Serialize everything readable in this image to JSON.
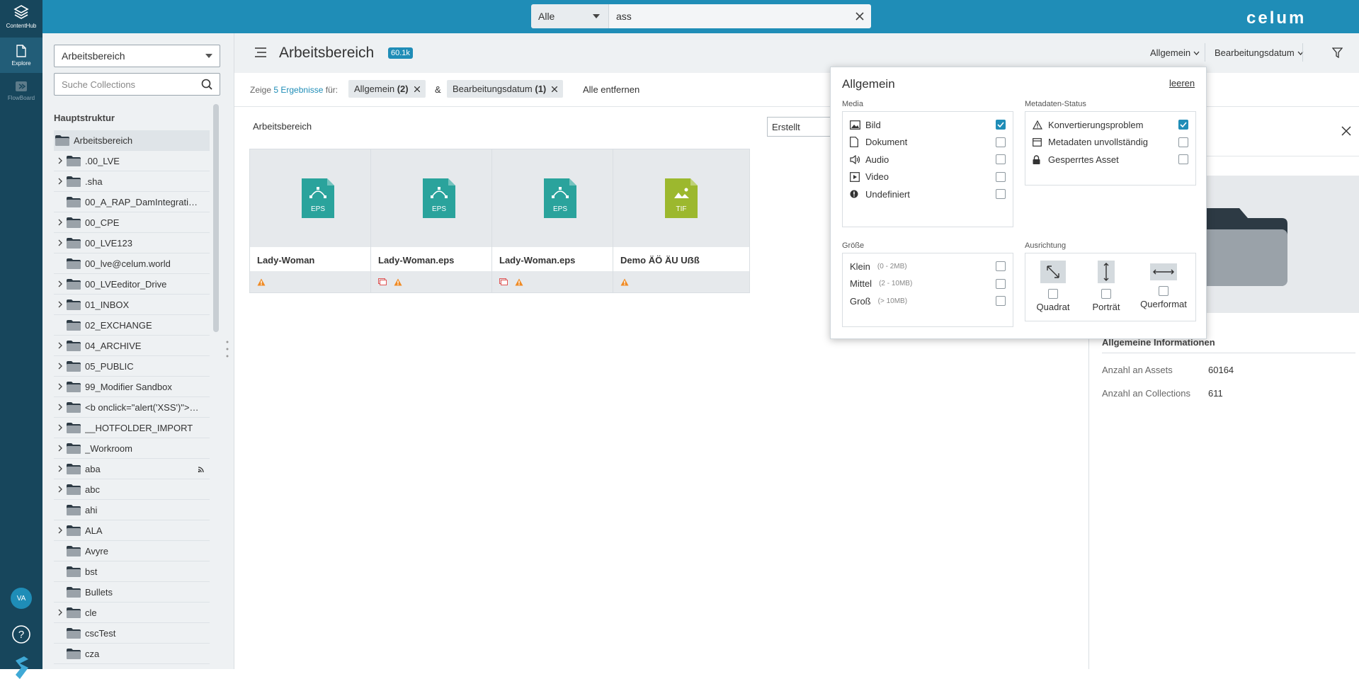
{
  "topbar": {
    "scope_value": "Alle",
    "query": "ass",
    "brand": "celum"
  },
  "leftnav": {
    "items": [
      {
        "label": "ContentHub"
      },
      {
        "label": "Explore"
      },
      {
        "label": "FlowBoard"
      }
    ],
    "avatar": "VA"
  },
  "sidebar": {
    "dropdown": "Arbeitsbereich",
    "search_placeholder": "Suche Collections",
    "tree_heading": "Hauptstruktur",
    "tree": [
      {
        "label": "Arbeitsbereich",
        "chev": false,
        "selected": true,
        "root": true
      },
      {
        "label": ".00_LVE",
        "chev": true
      },
      {
        "label": ".sha",
        "chev": true
      },
      {
        "label": "00_A_RAP_DamIntegrati…",
        "chev": false
      },
      {
        "label": "00_CPE",
        "chev": true
      },
      {
        "label": "00_LVE123",
        "chev": true
      },
      {
        "label": "00_lve@celum.world",
        "chev": false
      },
      {
        "label": "00_LVEeditor_Drive",
        "chev": true
      },
      {
        "label": "01_INBOX",
        "chev": true
      },
      {
        "label": "02_EXCHANGE",
        "chev": false
      },
      {
        "label": "04_ARCHIVE",
        "chev": true
      },
      {
        "label": "05_PUBLIC",
        "chev": true
      },
      {
        "label": "99_Modifier Sandbox",
        "chev": true
      },
      {
        "label": "<b onclick=\"alert('XSS')\">…",
        "chev": true
      },
      {
        "label": "__HOTFOLDER_IMPORT",
        "chev": true
      },
      {
        "label": "_Workroom",
        "chev": true
      },
      {
        "label": "aba",
        "chev": true,
        "feed": true
      },
      {
        "label": "abc",
        "chev": true
      },
      {
        "label": "ahi",
        "chev": false
      },
      {
        "label": "ALA",
        "chev": true
      },
      {
        "label": "Avyre",
        "chev": false
      },
      {
        "label": "bst",
        "chev": false
      },
      {
        "label": "Bullets",
        "chev": false
      },
      {
        "label": "cle",
        "chev": true
      },
      {
        "label": "cscTest",
        "chev": false
      },
      {
        "label": "cza",
        "chev": false
      }
    ]
  },
  "main": {
    "title": "Arbeitsbereich",
    "count_badge": "60.1k",
    "sort_general": "Allgemein",
    "sort_date": "Bearbeitungsdatum",
    "filterbar": {
      "prefix": "Zeige",
      "results": "5 Ergebnisse",
      "suffix": "für:",
      "chip1_label": "Allgemein",
      "chip1_count": "(2)",
      "amp": "&",
      "chip2_label": "Bearbeitungsdatum",
      "chip2_count": "(1)",
      "clear_all": "Alle entfernen"
    },
    "section_title": "Arbeitsbereich",
    "sort_select": "Erstellt",
    "cards": [
      {
        "name": "Lady-Woman",
        "type": "EPS",
        "color": "#2aa39c",
        "link_icon": false
      },
      {
        "name": "Lady-Woman.eps",
        "type": "EPS",
        "color": "#2aa39c",
        "link_icon": true
      },
      {
        "name": "Lady-Woman.eps",
        "type": "EPS",
        "color": "#2aa39c",
        "link_icon": true
      },
      {
        "name": "Demo ÄÖ ÄU Uẞß",
        "type": "TIF",
        "color": "#9cb82e",
        "link_icon": false
      }
    ]
  },
  "detail": {
    "info_heading": "Allgemeine Informationen",
    "rows": [
      {
        "label": "Anzahl an Assets",
        "value": "60164"
      },
      {
        "label": "Anzahl an Collections",
        "value": "611"
      }
    ]
  },
  "popup": {
    "title": "Allgemein",
    "clear": "leeren",
    "media_heading": "Media",
    "media": [
      {
        "label": "Bild",
        "icon": "image-icon",
        "checked": true
      },
      {
        "label": "Dokument",
        "icon": "document-icon",
        "checked": false
      },
      {
        "label": "Audio",
        "icon": "audio-icon",
        "checked": false
      },
      {
        "label": "Video",
        "icon": "video-icon",
        "checked": false
      },
      {
        "label": "Undefiniert",
        "icon": "undefined-icon",
        "checked": false
      }
    ],
    "meta_heading": "Metadaten-Status",
    "meta": [
      {
        "label": "Konvertierungsproblem",
        "icon": "warning-icon",
        "checked": true
      },
      {
        "label": "Metadaten unvollständig",
        "icon": "metadata-icon",
        "checked": false
      },
      {
        "label": "Gesperrtes Asset",
        "icon": "lock-icon",
        "checked": false
      }
    ],
    "size_heading": "Größe",
    "sizes": [
      {
        "label": "Klein",
        "range": "(0 - 2MB)"
      },
      {
        "label": "Mittel",
        "range": "(2 - 10MB)"
      },
      {
        "label": "Groß",
        "range": "(> 10MB)"
      }
    ],
    "orient_heading": "Ausrichtung",
    "orientations": [
      {
        "label": "Quadrat"
      },
      {
        "label": "Porträt"
      },
      {
        "label": "Querformat"
      }
    ]
  },
  "colors": {
    "accent": "#1f8db7",
    "nav_dark": "#17465c",
    "warning": "#f08a24",
    "link_red": "#e05555"
  }
}
